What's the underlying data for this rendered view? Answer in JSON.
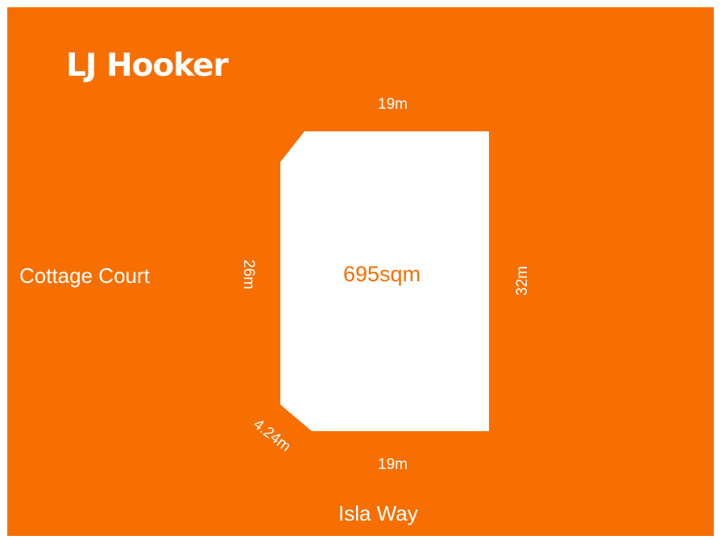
{
  "brand": {
    "logo_text": "LJ Hooker",
    "background_color": "#f76f00",
    "lot_color": "#ffffff"
  },
  "lot": {
    "area": "695sqm",
    "dimensions": {
      "top": "19m",
      "bottom": "19m",
      "left": "26m",
      "right": "32m",
      "corner": "4.24m"
    }
  },
  "streets": {
    "west": "Cottage Court",
    "south": "Isla Way"
  }
}
